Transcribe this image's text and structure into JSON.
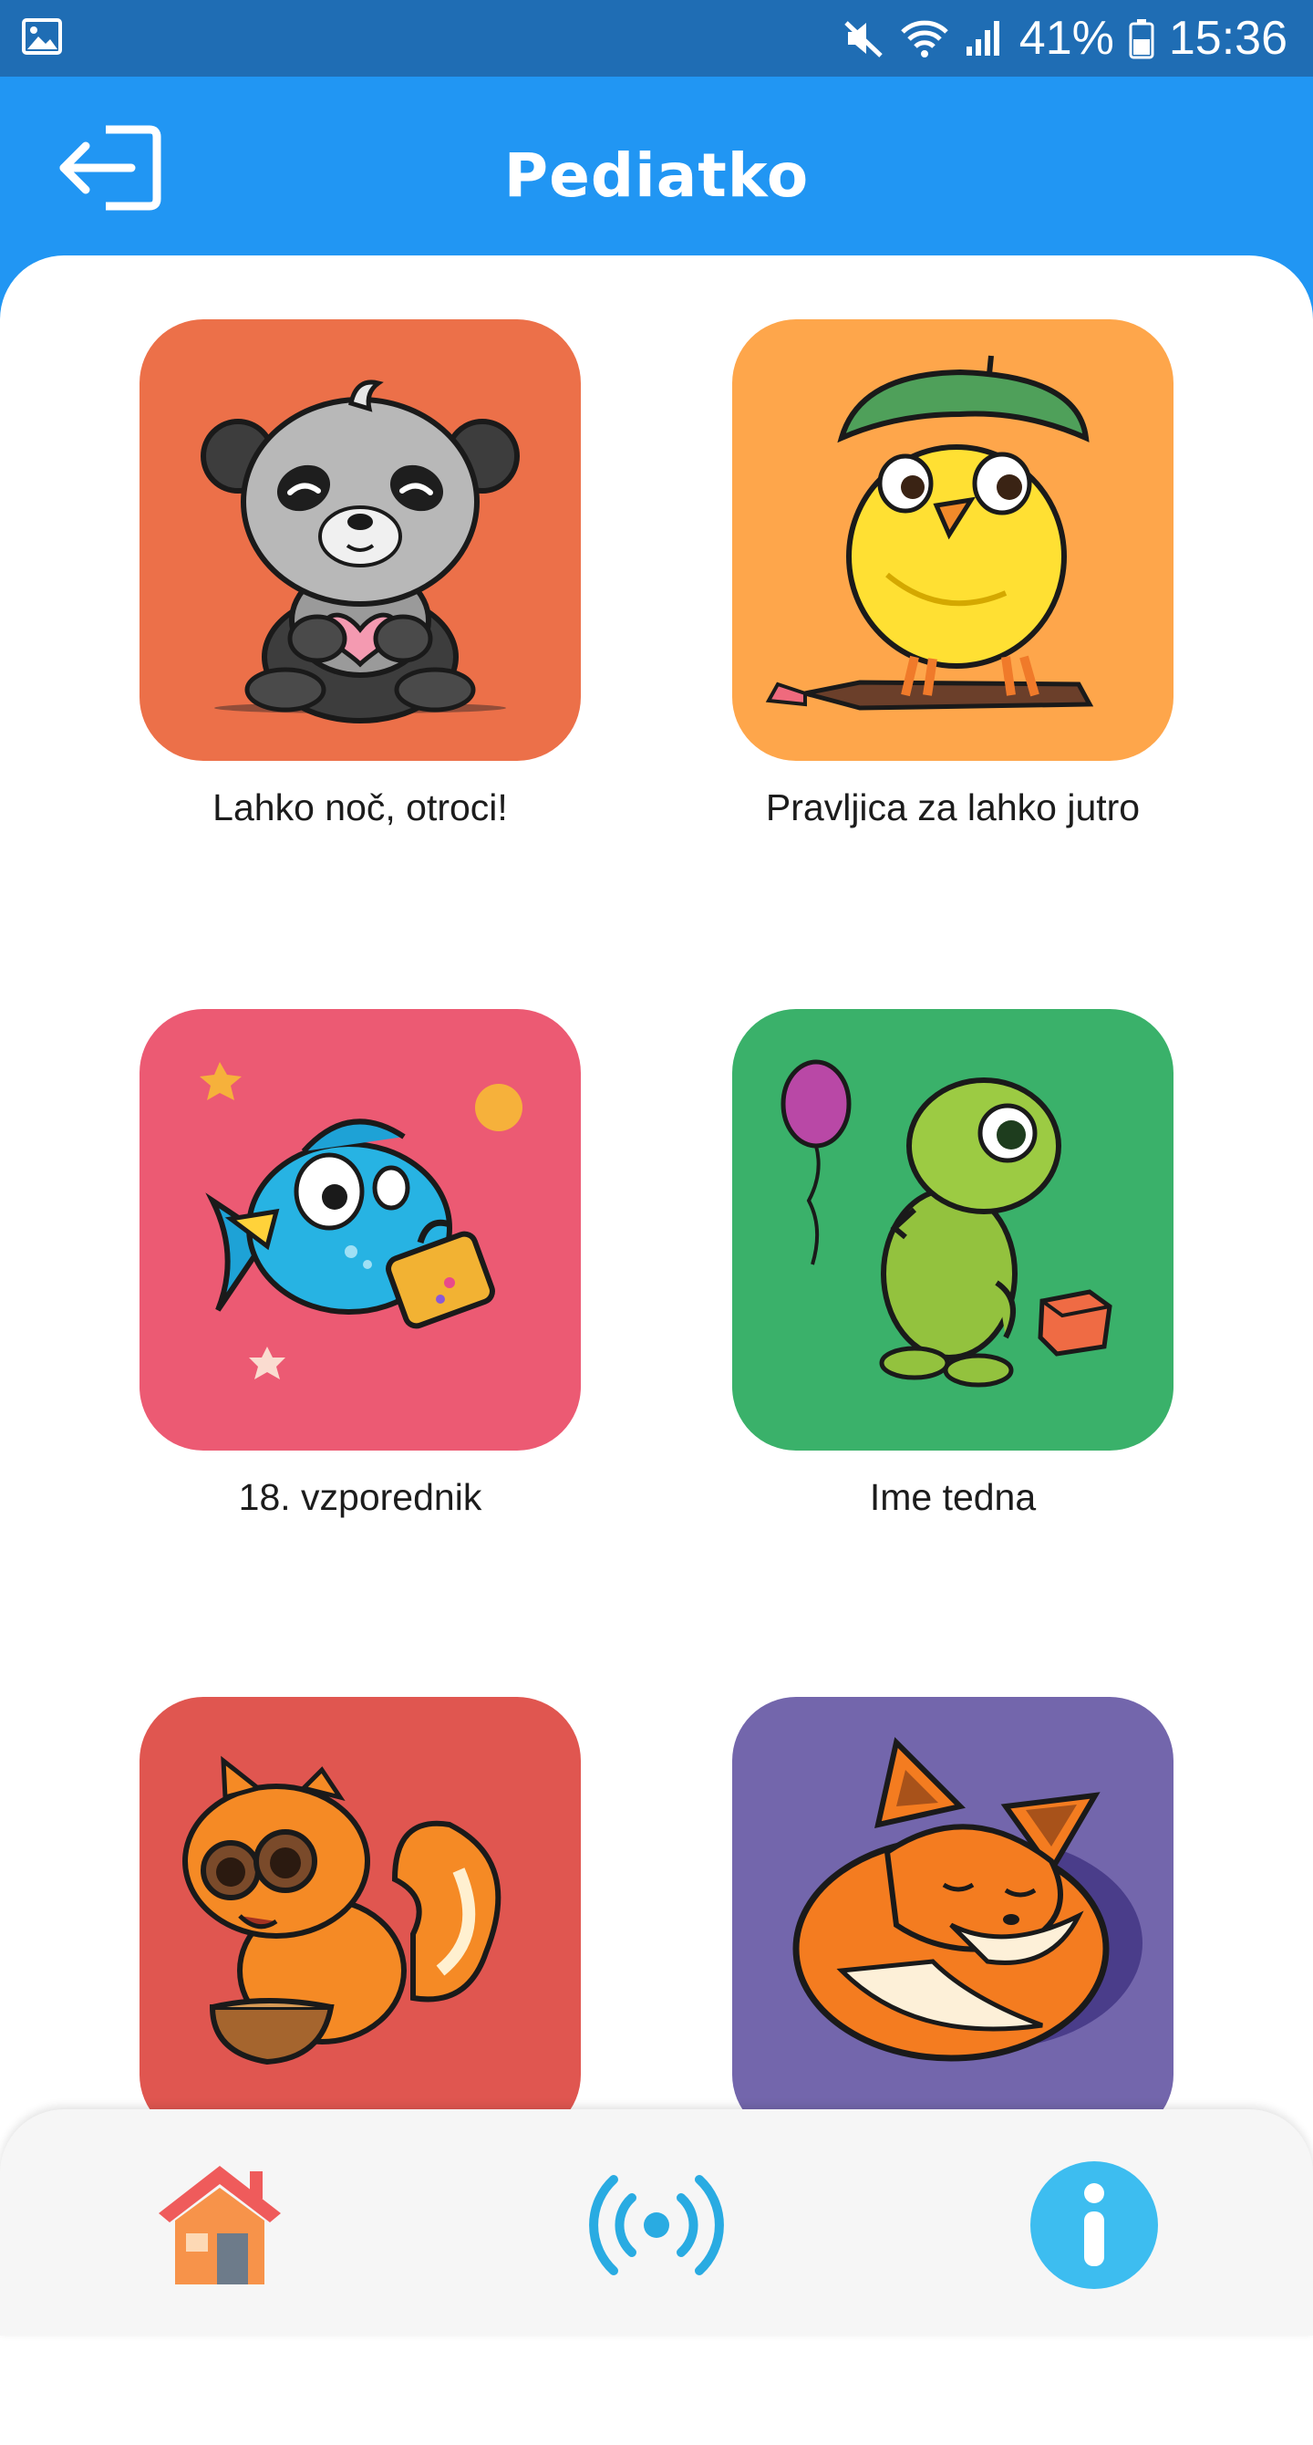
{
  "status_bar": {
    "battery": "41%",
    "time": "15:36",
    "icons": [
      "gallery-icon",
      "mute-icon",
      "wifi-icon",
      "signal-icon",
      "battery-icon"
    ]
  },
  "header": {
    "title": "Pediatko",
    "exit_icon": "exit-icon"
  },
  "cards": [
    {
      "label": "Lahko noč, otroci!",
      "color": "#ec7049",
      "art": "panda-illustration"
    },
    {
      "label": "Pravljica za lahko jutro",
      "color": "#fea64b",
      "art": "chick-illustration"
    },
    {
      "label": "18. vzporednik",
      "color": "#ec5a73",
      "art": "fish-illustration"
    },
    {
      "label": "Ime tedna",
      "color": "#3ab16a",
      "art": "dino-illustration"
    },
    {
      "label": "",
      "color": "#e05650",
      "art": "squirrel-illustration"
    },
    {
      "label": "",
      "color": "#7366ac",
      "art": "fox-illustration"
    }
  ],
  "bottom_nav": {
    "items": [
      "home-icon",
      "broadcast-icon",
      "info-icon"
    ]
  },
  "colors": {
    "status_bar": "#1f6db4",
    "header": "#2196f3",
    "sheet": "#ffffff",
    "nav_bar": "#f6f6f6",
    "info_blue": "#3dbdf0"
  }
}
